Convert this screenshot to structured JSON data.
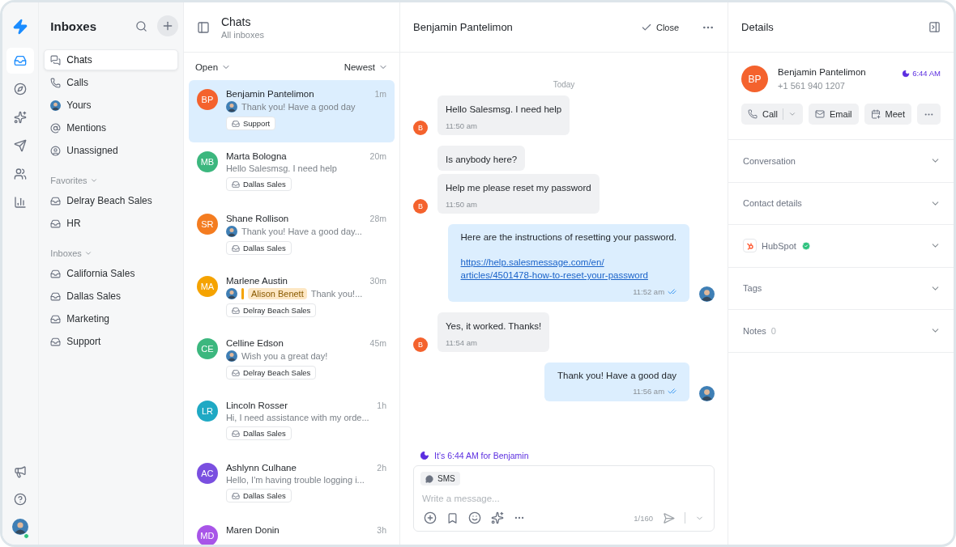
{
  "rail": {
    "top": [
      {
        "kind": "inbox",
        "selected": true
      },
      {
        "kind": "compass",
        "selected": false
      },
      {
        "kind": "sparkles",
        "selected": false
      },
      {
        "kind": "send",
        "selected": false
      },
      {
        "kind": "users",
        "selected": false
      },
      {
        "kind": "chart",
        "selected": false
      }
    ],
    "bottom": [
      {
        "kind": "megaphone"
      },
      {
        "kind": "help"
      },
      {
        "kind": "user"
      }
    ]
  },
  "sidebar": {
    "title": "Inboxes",
    "items": [
      {
        "label": "Chats",
        "kind": "chats",
        "selected": true
      },
      {
        "label": "Calls",
        "kind": "calls",
        "selected": false
      },
      {
        "label": "Yours",
        "kind": "yours",
        "selected": false
      },
      {
        "label": "Mentions",
        "kind": "mentions",
        "selected": false
      },
      {
        "label": "Unassigned",
        "kind": "unassigned",
        "selected": false
      }
    ],
    "groups": [
      {
        "title": "Favorites",
        "expanded": true,
        "items": [
          "Delray Beach Sales",
          "HR"
        ]
      },
      {
        "title": "Inboxes",
        "expanded": true,
        "items": [
          "California Sales",
          "Dallas Sales",
          "Marketing",
          "Support"
        ]
      }
    ]
  },
  "chat_list": {
    "title": "Chats",
    "subtitle": "All inboxes",
    "filter": "Open",
    "sort": "Newest",
    "chats": [
      {
        "initials": "BP",
        "color": "#f4622d",
        "name": "Benjamin Pantelimon",
        "time": "1m",
        "sender_photo": true,
        "preview": "Thank you! Have a good day",
        "inbox": "Support",
        "selected": true
      },
      {
        "initials": "MB",
        "color": "#3cb77e",
        "name": "Marta Bologna",
        "time": "20m",
        "sender_photo": false,
        "preview": "Hello Salesmsg. I need help",
        "inbox": "Dallas Sales",
        "selected": false
      },
      {
        "initials": "SR",
        "color": "#f47c20",
        "name": "Shane Rollison",
        "time": "28m",
        "sender_photo": true,
        "preview": "Thank you! Have a good day...",
        "inbox": "Dallas Sales",
        "selected": false
      },
      {
        "initials": "MA",
        "color": "#f5a300",
        "name": "Marlene Austin",
        "time": "30m",
        "sender_photo": true,
        "mention": "Alison Benett",
        "preview": "Thank you!...",
        "inbox": "Delray Beach Sales",
        "selected": false
      },
      {
        "initials": "CE",
        "color": "#3cb77e",
        "name": "Celline Edson",
        "time": "45m",
        "sender_photo": true,
        "preview": "Wish you a great day!",
        "inbox": "Delray Beach Sales",
        "selected": false
      },
      {
        "initials": "LR",
        "color": "#1fa9c4",
        "name": "Lincoln Rosser",
        "time": "1h",
        "sender_photo": false,
        "preview": "Hi, I need assistance with my orde...",
        "inbox": "Dallas Sales",
        "selected": false
      },
      {
        "initials": "AC",
        "color": "#7a4fe0",
        "name": "Ashlynn Culhane",
        "time": "2h",
        "sender_photo": false,
        "preview": "Hello, I'm having trouble logging i...",
        "inbox": "Dallas Sales",
        "selected": false
      },
      {
        "initials": "MD",
        "color": "#a855e8",
        "name": "Maren Donin",
        "time": "3h",
        "selected": false
      }
    ]
  },
  "conversation": {
    "title": "Benjamin Pantelimon",
    "close": "Close",
    "day": "Today",
    "messages": [
      {
        "kind": "incoming",
        "text": "Hello Salesmsg. I need help",
        "time": "11:50 am",
        "avatar": "B"
      },
      {
        "kind": "incoming",
        "text": "Is anybody here?"
      },
      {
        "kind": "incoming",
        "text": "Help me please reset my password",
        "time": "11:50 am",
        "avatar": "B"
      },
      {
        "kind": "outgoing",
        "text": "Here are the instructions of resetting your password.",
        "link": "https://help.salesmessage.com/en/articles/4501478-how-to-reset-your-password",
        "time": "11:52 am",
        "read": true,
        "photo": true
      },
      {
        "kind": "incoming",
        "text": "Yes, it worked. Thanks!",
        "time": "11:54 am",
        "avatar": "B"
      },
      {
        "kind": "outgoing",
        "text": "Thank you! Have a good day",
        "time": "11:56 am",
        "read": true,
        "photo": true
      }
    ],
    "local_time_note": "It’s 6:44 AM for Benjamin",
    "composer": {
      "channel": "SMS",
      "placeholder": "Write a message...",
      "counter": "1/160"
    }
  },
  "details": {
    "title": "Details",
    "contact": {
      "initials": "BP",
      "name": "Benjamin Pantelimon",
      "phone": "+1 561 940 1207",
      "local_time": "6:44 AM"
    },
    "actions": [
      {
        "kind": "call",
        "label": "Call"
      },
      {
        "kind": "email",
        "label": "Email"
      },
      {
        "kind": "meet",
        "label": "Meet"
      },
      {
        "kind": "more"
      }
    ],
    "sections": [
      {
        "label": "Conversation",
        "expanded": false
      },
      {
        "label": "Contact details",
        "expanded": false
      },
      {
        "label": "HubSpot",
        "kind": "hubspot",
        "verified": true,
        "expanded": false
      },
      {
        "label": "Tags",
        "expanded": false
      },
      {
        "label": "Notes",
        "count": "0",
        "expanded": false
      }
    ]
  }
}
